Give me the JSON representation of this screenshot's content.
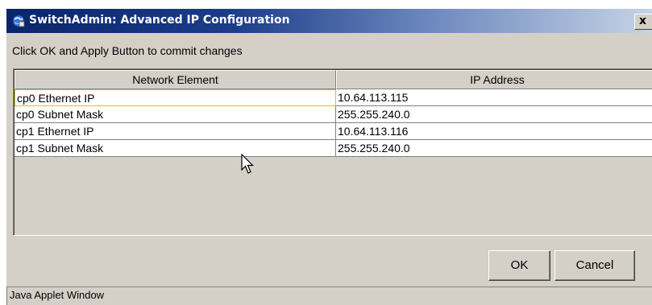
{
  "window": {
    "title": "SwitchAdmin: Advanced IP Configuration",
    "close_label": "x"
  },
  "instruction": "Click OK and Apply Button to commit changes",
  "table": {
    "columns": [
      "Network Element",
      "IP Address"
    ],
    "rows": [
      {
        "element": "cp0 Ethernet IP",
        "ip": "10.64.113.115"
      },
      {
        "element": "cp0 Subnet Mask",
        "ip": "255.255.240.0"
      },
      {
        "element": "cp1 Ethernet IP",
        "ip": "10.64.113.116"
      },
      {
        "element": "cp1 Subnet Mask",
        "ip": "255.255.240.0"
      }
    ]
  },
  "buttons": {
    "ok": "OK",
    "cancel": "Cancel"
  },
  "status": "Java Applet Window",
  "icons": {
    "title": "globe-applet-icon",
    "cursor": "mouse-pointer-icon"
  },
  "colors": {
    "titlebar_start": "#0a246a",
    "titlebar_end": "#c6d3e6",
    "dialog_bg": "#d4d0c8",
    "focus_border": "#e0c000"
  }
}
